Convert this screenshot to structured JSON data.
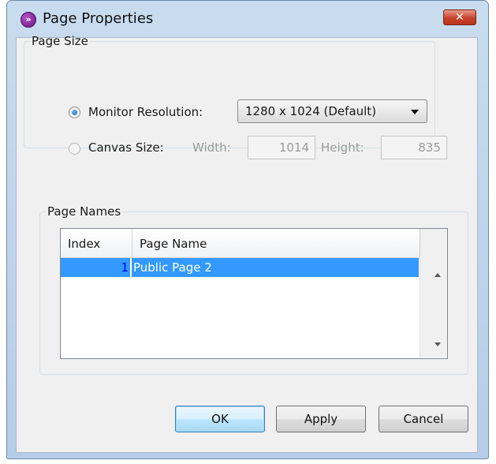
{
  "window": {
    "title": "Page Properties",
    "app_icon": "purple-arrow-icon",
    "close_icon": "close-x-icon"
  },
  "page_size": {
    "legend": "Page Size",
    "monitor_resolution": {
      "label": "Monitor Resolution:",
      "selected": true,
      "value": "1280 x 1024 (Default)"
    },
    "canvas_size": {
      "label": "Canvas Size:",
      "selected": false,
      "width_label": "Width:",
      "width": "1014",
      "height_label": "Height:",
      "height": "835"
    }
  },
  "page_names": {
    "legend": "Page Names",
    "columns": [
      "Index",
      "Page Name"
    ],
    "rows": [
      {
        "index": "1",
        "name": "Public Page 2"
      }
    ]
  },
  "buttons": {
    "ok": "OK",
    "apply": "Apply",
    "cancel": "Cancel"
  },
  "colors": {
    "selection": "#3399ff",
    "close_button": "#c7422c",
    "frame": "#b9d1ea"
  }
}
